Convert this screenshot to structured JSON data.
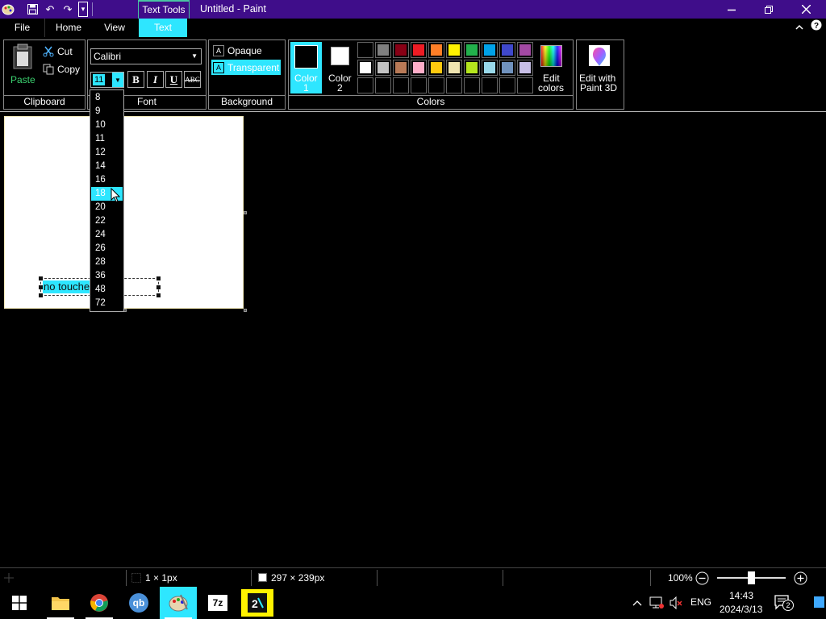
{
  "titlebar": {
    "context_tab": "Text Tools",
    "title": "Untitled - Paint",
    "minimize_glyph": "–",
    "restore_glyph": "❐",
    "close_glyph": "✕",
    "undo_glyph": "↶",
    "redo_glyph": "↷",
    "dropdown_glyph": "▾"
  },
  "tabs": {
    "file": "File",
    "home": "Home",
    "view": "View",
    "text": "Text",
    "collapse_glyph": "⌃",
    "help_glyph": "?"
  },
  "clipboard": {
    "paste": "Paste",
    "cut": "Cut",
    "copy": "Copy",
    "label": "Clipboard"
  },
  "font": {
    "family": "Calibri",
    "size": "11",
    "label": "Font",
    "bold": "B",
    "italic": "I",
    "underline": "U",
    "strike": "ABC",
    "sizes": [
      "8",
      "9",
      "10",
      "11",
      "12",
      "14",
      "16",
      "18",
      "20",
      "22",
      "24",
      "26",
      "28",
      "36",
      "48",
      "72"
    ],
    "highlighted_size": "18"
  },
  "background": {
    "opaque": "Opaque",
    "transparent": "Transparent",
    "label": "Background"
  },
  "colors": {
    "color1_label_line1": "Color",
    "color1_label_line2": "1",
    "color2_label_line1": "Color",
    "color2_label_line2": "2",
    "color1": "#000000",
    "color2": "#ffffff",
    "edit_colors_line1": "Edit",
    "edit_colors_line2": "colors",
    "label": "Colors",
    "palette_row1": [
      "#000000",
      "#7f7f7f",
      "#880015",
      "#ed1c24",
      "#ff7f27",
      "#fff200",
      "#22b14c",
      "#00a2e8",
      "#3f48cc",
      "#a349a4"
    ],
    "palette_row2": [
      "#ffffff",
      "#c3c3c3",
      "#b97a57",
      "#ffaec9",
      "#ffc90e",
      "#efe4b0",
      "#b5e61d",
      "#99d9ea",
      "#7092be",
      "#c8bfe7"
    ]
  },
  "paint3d": {
    "line1": "Edit with",
    "line2": "Paint 3D"
  },
  "canvas": {
    "text": "no touche"
  },
  "statusbar": {
    "selection_size": "1 × 1px",
    "canvas_size": "297 × 239px",
    "zoom": "100%"
  },
  "taskbar": {
    "language": "ENG",
    "time": "14:43",
    "date": "2024/3/13",
    "notifications": "2",
    "qb": "qb",
    "sevenzip": "7z"
  }
}
